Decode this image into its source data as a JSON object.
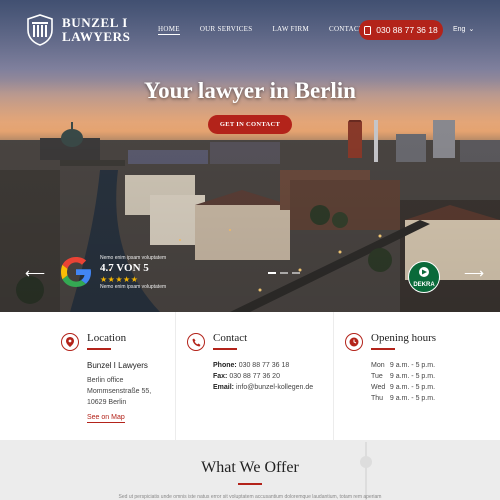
{
  "brand": {
    "line1": "BUNZEL I",
    "line2": "LAWYERS"
  },
  "nav": {
    "items": [
      "HOME",
      "OUR SERVICES",
      "LAW FIRM",
      "CONTACT US"
    ]
  },
  "phone": "030 88 77 36 18",
  "lang": "Eng",
  "hero": {
    "title": "Your lawyer in Berlin",
    "cta": "GET IN CONTACT"
  },
  "review": {
    "top": "Nemo enim ipsam voluptatem",
    "score": "4.7 VON 5",
    "stars": "★★★★★",
    "bottom": "Nemo enim ipsam voluptatem"
  },
  "dekra": "DEKRA",
  "location": {
    "title": "Location",
    "firm": "Bunzel I Lawyers",
    "lines": [
      "Berlin office",
      "Mommsenstraße 55,",
      "10629 Berlin"
    ],
    "link": "See on Map"
  },
  "contact": {
    "title": "Contact",
    "phone_label": "Phone:",
    "phone": "030 88 77 36 18",
    "fax_label": "Fax:",
    "fax": "030 88 77 36 20",
    "email_label": "Email:",
    "email": "info@bunzel-kollegen.de"
  },
  "hours": {
    "title": "Opening hours",
    "rows": [
      {
        "day": "Mon",
        "time": "9 a.m. - 5 p.m."
      },
      {
        "day": "Tue",
        "time": "9 a.m. - 5 p.m."
      },
      {
        "day": "Wed",
        "time": "9 a.m. - 5 p.m."
      },
      {
        "day": "Thu",
        "time": "9 a.m. - 5 p.m."
      }
    ]
  },
  "offer": {
    "title": "What We Offer",
    "text": "Sed ut perspiciatis unde omnis iste natus error sit voluptatem accusantium doloremque laudantium, totam rem aperiam"
  },
  "colors": {
    "accent": "#b3231a"
  },
  "icons": [
    "location-pin-icon",
    "phone-icon",
    "clock-icon",
    "mobile-phone-icon",
    "chevron-down-icon",
    "arrow-left-icon",
    "arrow-right-icon",
    "google-icon",
    "dekra-badge",
    "shield-logo"
  ]
}
